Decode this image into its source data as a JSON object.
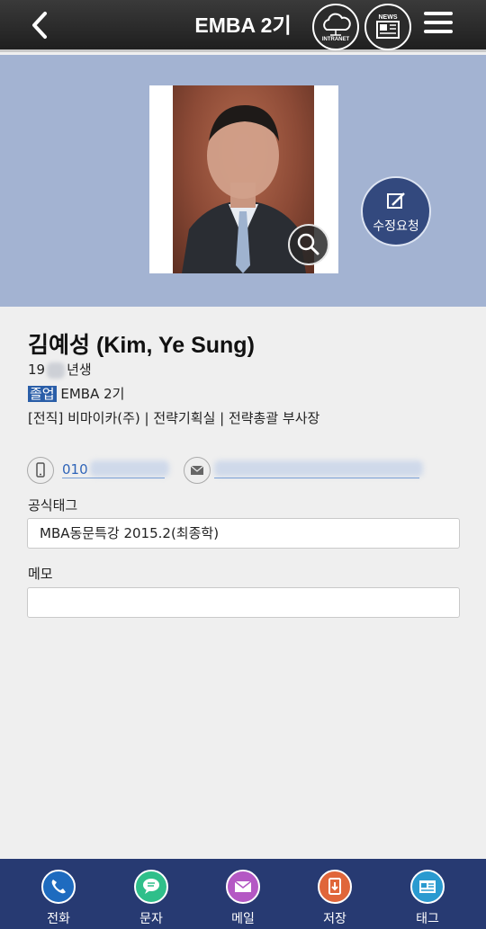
{
  "header": {
    "title": "EMBA 2기",
    "intranet_label": "INTRANET",
    "news_label": "NEWS"
  },
  "profile": {
    "edit_request_label": "수정요청",
    "name": "김예성 (Kim, Ye Sung)",
    "birth_prefix": "19",
    "birth_suffix": "년생",
    "status_badge": "졸업",
    "program": "EMBA 2기",
    "career": "[전직] 비마이카(주) | 전략기획실 | 전략총괄 부사장",
    "phone_prefix": "010"
  },
  "fields": {
    "official_tag_label": "공식태그",
    "official_tag_value": "MBA동문특강 2015.2(최종학)",
    "memo_label": "메모",
    "memo_value": ""
  },
  "nav": {
    "items": [
      {
        "label": "전화",
        "icon": "phone-icon",
        "color": "#1e6bbf"
      },
      {
        "label": "문자",
        "icon": "chat-icon",
        "color": "#2fbf8a"
      },
      {
        "label": "메일",
        "icon": "mail-icon",
        "color": "#b458c4"
      },
      {
        "label": "저장",
        "icon": "save-icon",
        "color": "#e0663a"
      },
      {
        "label": "태그",
        "icon": "tag-icon",
        "color": "#2a9ad0"
      }
    ]
  }
}
